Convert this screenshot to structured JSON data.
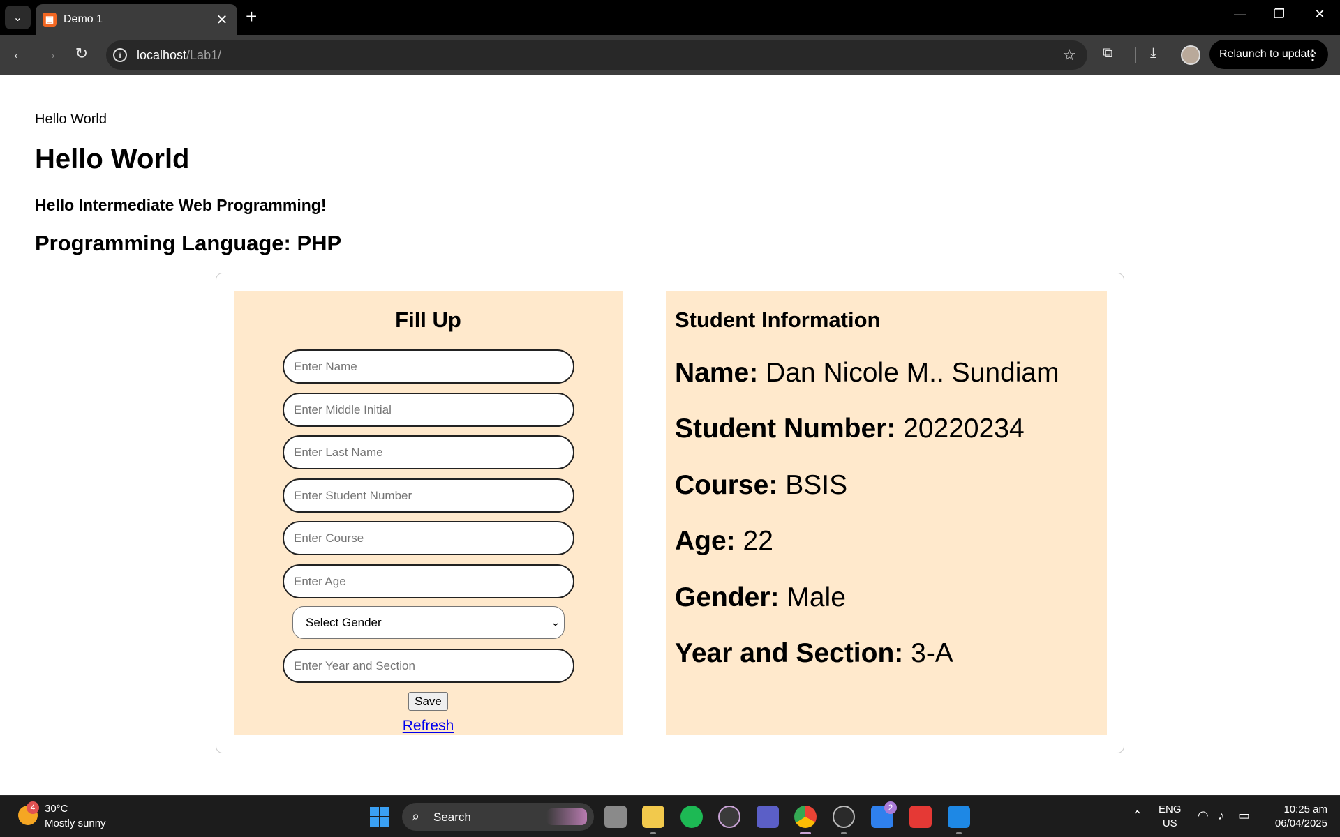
{
  "browser": {
    "tab_title": "Demo 1",
    "tab_close": "✕",
    "new_tab": "+",
    "url_host": "localhost",
    "url_path": "/Lab1/",
    "relaunch_label": "Relaunch to update",
    "minimize": "—",
    "restore": "❐",
    "close": "✕"
  },
  "page": {
    "paragraph": "Hello World",
    "h1": "Hello World",
    "h3": "Hello Intermediate Web Programming!",
    "h2": "Programming Language: PHP"
  },
  "form": {
    "title": "Fill Up",
    "fields": [
      {
        "placeholder": "Enter Name"
      },
      {
        "placeholder": "Enter Middle Initial"
      },
      {
        "placeholder": "Enter Last Name"
      },
      {
        "placeholder": "Enter Student Number"
      },
      {
        "placeholder": "Enter Course"
      },
      {
        "placeholder": "Enter Age"
      },
      {
        "placeholder": "Enter Year and Section"
      }
    ],
    "gender_select": "Select Gender",
    "save_label": "Save",
    "refresh_label": "Refresh"
  },
  "student_info": {
    "title": "Student Information",
    "rows": [
      {
        "label": "Name:",
        "value": "Dan Nicole M.. Sundiam"
      },
      {
        "label": "Student Number:",
        "value": "20220234"
      },
      {
        "label": "Course:",
        "value": "BSIS"
      },
      {
        "label": "Age:",
        "value": "22"
      },
      {
        "label": "Gender:",
        "value": "Male"
      },
      {
        "label": "Year and Section:",
        "value": "3-A"
      }
    ]
  },
  "taskbar": {
    "weather_badge": "4",
    "temperature": "30°C",
    "weather_desc": "Mostly sunny",
    "search_label": "Search",
    "teams_badge": "2",
    "lang_line1": "ENG",
    "lang_line2": "US",
    "time": "10:25 am",
    "date": "06/04/2025"
  },
  "colors": {
    "panel_bg": "#ffe9cc",
    "link": "#0000ee",
    "chrome_dark": "#3c3c3c"
  }
}
